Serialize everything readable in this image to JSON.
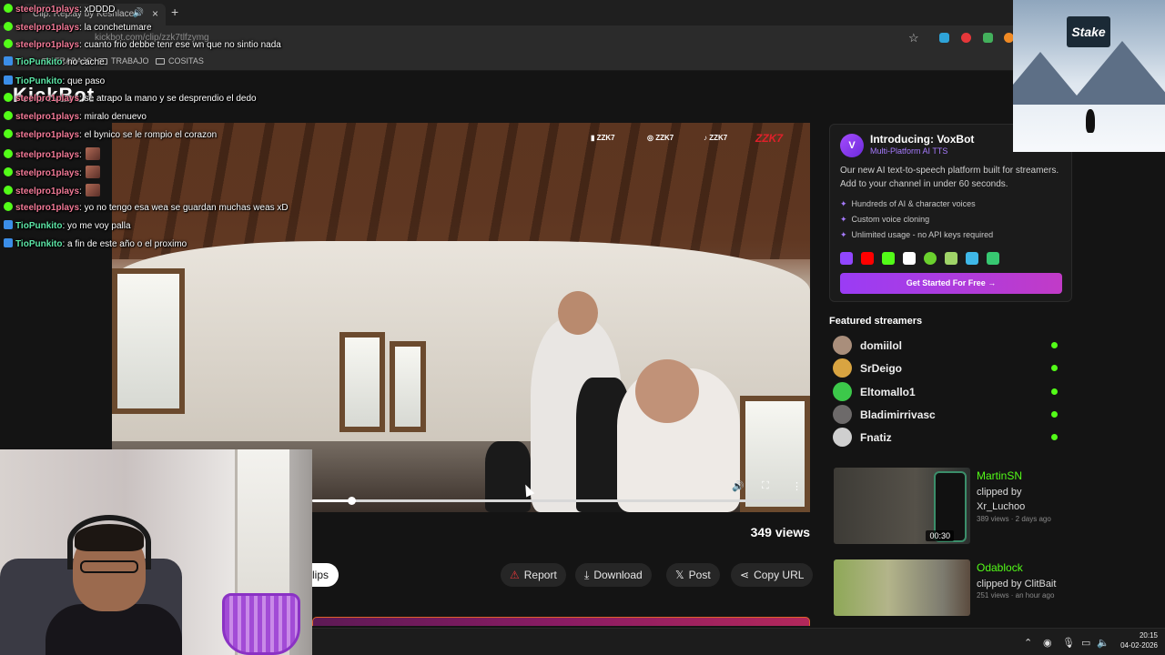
{
  "browser": {
    "tab_title": "Clip: Replay by Keshlacer",
    "address": "kickbot.com/clip/zzk7tlfzymg",
    "bookmarks": [
      "TRABAJO",
      "TRABAJO",
      "COSITAS"
    ]
  },
  "brand": {
    "logo_text": "KickBot"
  },
  "video": {
    "overlay_socials": [
      "ZZK7",
      "ZZK7",
      "ZZK7"
    ],
    "overlay_brand": "ZZK7",
    "progress_fraction": 0.08,
    "views": "349 views"
  },
  "actions": {
    "clips_label": "lips",
    "report": "Report",
    "download": "Download",
    "post": "Post",
    "copy_url": "Copy URL"
  },
  "promo": {
    "title": "Introducing: VoxBot",
    "subtitle": "Multi-Platform AI TTS",
    "description": "Our new AI text-to-speech platform built for streamers. Add to your channel in under 60 seconds.",
    "features": [
      "Hundreds of AI & character voices",
      "Custom voice cloning",
      "Unlimited usage - no API keys required"
    ],
    "cta": "Get Started For Free →"
  },
  "featured": {
    "title": "Featured streamers",
    "streamers": [
      {
        "name": "domiilol"
      },
      {
        "name": "SrDeigo"
      },
      {
        "name": "Eltomallo1"
      },
      {
        "name": "Bladimirrivasc"
      },
      {
        "name": "Fnatiz"
      }
    ]
  },
  "clips": [
    {
      "channel": "MartinSN",
      "by": "clipped by Xr_Luchoo",
      "meta": "389 views · 2 days ago",
      "duration": "00:30"
    },
    {
      "channel": "Odablock",
      "by": "clipped by ClitBait",
      "meta": "251 views · an hour ago",
      "duration": ""
    }
  ],
  "ad": {
    "brand": "Stake"
  },
  "chat": [
    {
      "user": "steelpro1plays",
      "text": ": xDDDD",
      "badge": "green",
      "color": "red",
      "emote": false
    },
    {
      "user": "steelpro1plays",
      "text": ": la conchetumare",
      "badge": "green",
      "color": "red",
      "emote": false
    },
    {
      "user": "steelpro1plays",
      "text": ": cuanto frio debbe tenr ese wn que no sintio nada",
      "badge": "green",
      "color": "red",
      "emote": false
    },
    {
      "user": "TioPunkito",
      "text": ": no cache",
      "badge": "blue",
      "color": "green",
      "emote": false
    },
    {
      "user": "TioPunkito",
      "text": ": que paso",
      "badge": "blue",
      "color": "green",
      "emote": false
    },
    {
      "user": "steelpro1plays",
      "text": ": se atrapo la mano y se desprendio el dedo",
      "badge": "green",
      "color": "red",
      "emote": false
    },
    {
      "user": "steelpro1plays",
      "text": ": miralo denuevo",
      "badge": "green",
      "color": "red",
      "emote": false
    },
    {
      "user": "steelpro1plays",
      "text": ": el bynico se le rompio el corazon",
      "badge": "green",
      "color": "red",
      "emote": false
    },
    {
      "user": "steelpro1plays",
      "text": ":",
      "badge": "green",
      "color": "red",
      "emote": true
    },
    {
      "user": "steelpro1plays",
      "text": ":",
      "badge": "green",
      "color": "red",
      "emote": true
    },
    {
      "user": "steelpro1plays",
      "text": ":",
      "badge": "green",
      "color": "red",
      "emote": true
    },
    {
      "user": "steelpro1plays",
      "text": ": yo no tengo esa wea se guardan muchas weas xD",
      "badge": "green",
      "color": "red",
      "emote": false
    },
    {
      "user": "TioPunkito",
      "text": ": yo me voy palla",
      "badge": "blue",
      "color": "green",
      "emote": false
    },
    {
      "user": "TioPunkito",
      "text": ": a fin de este año o el proximo",
      "badge": "blue",
      "color": "green",
      "emote": false
    }
  ],
  "taskbar": {
    "time": "20:15",
    "date": "04-02-2026"
  },
  "colors": {
    "kick_green": "#53fc18",
    "promo_purple": "#a77bff",
    "page_bg": "#141414"
  }
}
